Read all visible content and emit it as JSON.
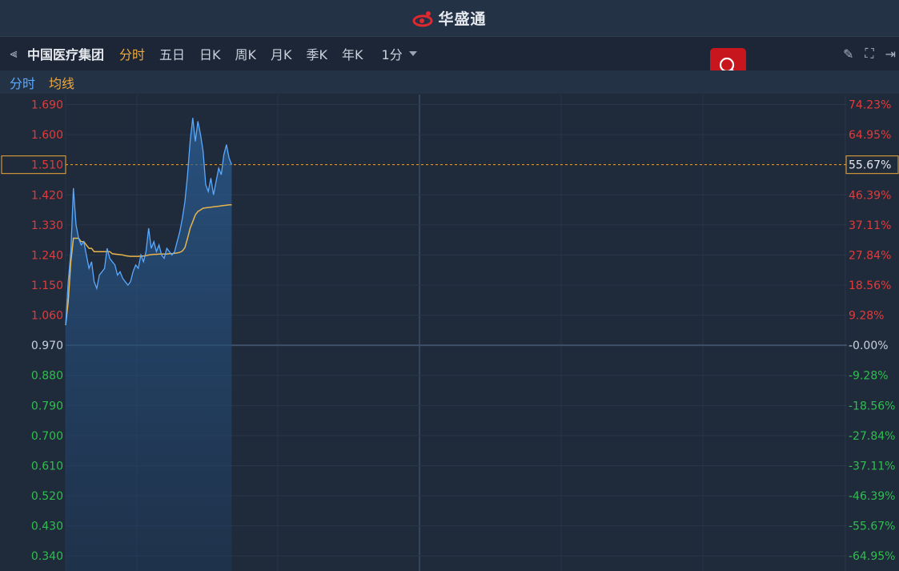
{
  "app": {
    "brand_name": "华盛通"
  },
  "toolbar": {
    "stock_name": "中国医疗集团",
    "periods": [
      "分时",
      "五日",
      "日K",
      "周K",
      "月K",
      "季K",
      "年K"
    ],
    "active_period": "分时",
    "interval": "1分"
  },
  "legend": {
    "line_label": "分时",
    "avg_label": "均线"
  },
  "colors": {
    "up": "#e33b3b",
    "down": "#2fbf4f",
    "price_line": "#5aa9ff",
    "avg_line": "#e8b54a",
    "highlight": "#f0a93a"
  },
  "chart_data": {
    "type": "line",
    "prev_close": 0.97,
    "current_price_label": "1.510",
    "current_pct_label": "55.67%",
    "ylim": [
      0.295,
      1.72
    ],
    "yticks_left": [
      "1.690",
      "1.600",
      "1.510",
      "1.420",
      "1.330",
      "1.240",
      "1.150",
      "1.060",
      "0.970",
      "0.880",
      "0.790",
      "0.700",
      "0.610",
      "0.520",
      "0.430",
      "0.340"
    ],
    "yticks_right": [
      "74.23%",
      "64.95%",
      "55.67%",
      "46.39%",
      "37.11%",
      "27.84%",
      "18.56%",
      "9.28%",
      "-0.00%",
      "-9.28%",
      "-18.56%",
      "-27.84%",
      "-37.11%",
      "-46.39%",
      "-55.67%",
      "-64.95%"
    ],
    "session_minutes": 330,
    "series": [
      {
        "name": "分时",
        "values": [
          1.03,
          1.16,
          1.25,
          1.44,
          1.33,
          1.29,
          1.27,
          1.28,
          1.24,
          1.2,
          1.22,
          1.16,
          1.14,
          1.18,
          1.19,
          1.2,
          1.26,
          1.23,
          1.22,
          1.21,
          1.18,
          1.19,
          1.17,
          1.16,
          1.15,
          1.16,
          1.19,
          1.21,
          1.2,
          1.24,
          1.22,
          1.25,
          1.32,
          1.26,
          1.28,
          1.25,
          1.27,
          1.24,
          1.23,
          1.26,
          1.25,
          1.24,
          1.25,
          1.28,
          1.31,
          1.35,
          1.4,
          1.48,
          1.58,
          1.65,
          1.58,
          1.64,
          1.6,
          1.55,
          1.45,
          1.43,
          1.47,
          1.42,
          1.46,
          1.5,
          1.48,
          1.54,
          1.57,
          1.53,
          1.51
        ]
      },
      {
        "name": "均线",
        "values": [
          1.03,
          1.1,
          1.22,
          1.29,
          1.29,
          1.29,
          1.28,
          1.28,
          1.27,
          1.26,
          1.26,
          1.25,
          1.25,
          1.25,
          1.25,
          1.25,
          1.25,
          1.25,
          1.244,
          1.243,
          1.242,
          1.241,
          1.24,
          1.238,
          1.237,
          1.236,
          1.236,
          1.236,
          1.236,
          1.237,
          1.237,
          1.238,
          1.24,
          1.241,
          1.242,
          1.242,
          1.243,
          1.243,
          1.243,
          1.243,
          1.244,
          1.244,
          1.245,
          1.246,
          1.248,
          1.252,
          1.262,
          1.29,
          1.32,
          1.34,
          1.36,
          1.37,
          1.375,
          1.38,
          1.381,
          1.382,
          1.383,
          1.384,
          1.385,
          1.386,
          1.387,
          1.388,
          1.389,
          1.39,
          1.39
        ]
      }
    ]
  }
}
